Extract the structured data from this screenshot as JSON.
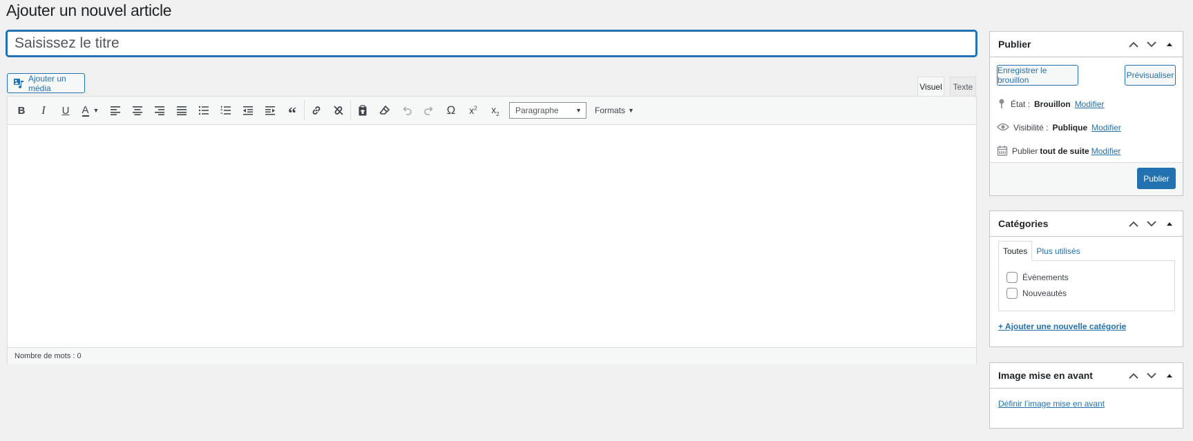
{
  "page": {
    "title": "Ajouter un nouvel article"
  },
  "title_field": {
    "placeholder": "Saisissez le titre",
    "value": ""
  },
  "media": {
    "button_label": "Ajouter un média"
  },
  "editor": {
    "tabs": [
      {
        "label": "Visuel",
        "active": true
      },
      {
        "label": "Texte",
        "active": false
      }
    ],
    "toolbar": {
      "buttons": [
        "bold-icon",
        "italic-icon",
        "underline-icon",
        "text-color-icon",
        "align-left-icon",
        "align-center-icon",
        "align-right-icon",
        "align-justify-icon",
        "bullet-list-icon",
        "numbered-list-icon",
        "outdent-icon",
        "indent-icon",
        "blockquote-icon",
        "link-icon",
        "unlink-icon",
        "paste-text-icon",
        "clear-formatting-icon",
        "undo-icon",
        "redo-icon",
        "special-char-icon",
        "superscript-icon",
        "subscript-icon"
      ],
      "format_select": "Paragraphe",
      "formats_menu": "Formats"
    },
    "word_count": "Nombre de mots : 0"
  },
  "publish_box": {
    "title": "Publier",
    "save_draft": "Enregistrer le brouillon",
    "preview": "Prévisualiser",
    "status_label": "État :",
    "status_value": "Brouillon",
    "visibility_label": "Visibilité :",
    "visibility_value": "Publique",
    "publish_label": "Publier",
    "publish_value": "tout de suite",
    "edit_link": "Modifier",
    "publish_button": "Publier"
  },
  "categories_box": {
    "title": "Catégories",
    "tabs": [
      {
        "label": "Toutes",
        "active": true
      },
      {
        "label": "Plus utilisés",
        "active": false
      }
    ],
    "items": [
      {
        "label": "Évènements",
        "checked": false
      },
      {
        "label": "Nouveautés",
        "checked": false
      }
    ],
    "add_link": "+ Ajouter une nouvelle catégorie"
  },
  "featured_box": {
    "title": "Image mise en avant",
    "link": "Définir l’image mise en avant"
  },
  "colors": {
    "accent": "#2271b1",
    "background": "#f0f0f1",
    "text": "#1d2327"
  }
}
